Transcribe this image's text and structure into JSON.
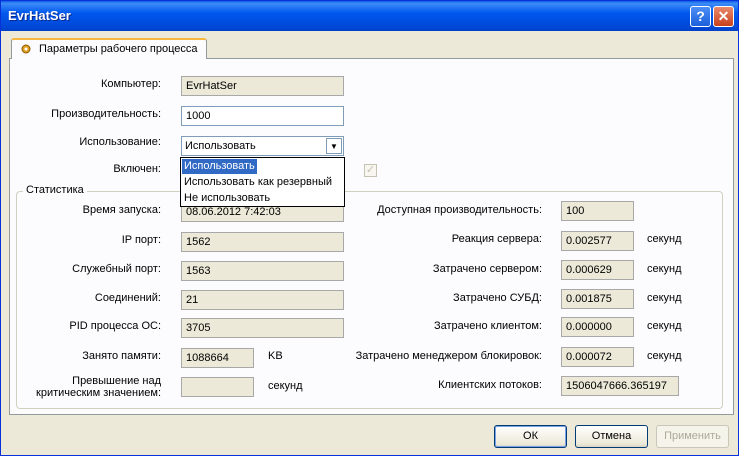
{
  "window": {
    "title": "EvrHatSer"
  },
  "titlebar": {
    "help_label": "?",
    "close_label": "✕"
  },
  "tab": {
    "label": "Параметры рабочего процесса",
    "icon": "gear-icon"
  },
  "form": {
    "computer_label": "Компьютер:",
    "computer_value": "EvrHatSer",
    "performance_label": "Производительность:",
    "performance_value": "1000",
    "usage_label": "Использование:",
    "usage_value": "Использовать",
    "usage_options": [
      "Использовать",
      "Использовать как резервный",
      "Не использовать"
    ],
    "enabled_label": "Включен:",
    "enabled_checked": true
  },
  "stats": {
    "title": "Статистика",
    "start_time_label": "Время запуска:",
    "start_time_value": "08.06.2012 7:42:03",
    "ip_port_label": "IP порт:",
    "ip_port_value": "1562",
    "service_port_label": "Служебный порт:",
    "service_port_value": "1563",
    "connections_label": "Соединений:",
    "connections_value": "21",
    "pid_label": "PID процесса ОС:",
    "pid_value": "3705",
    "memory_label": "Занято памяти:",
    "memory_value": "1088664",
    "memory_unit": "KB",
    "critical_label": "Превышение над критическим значением:",
    "critical_value": "",
    "critical_unit": "секунд",
    "available_perf_label": "Доступная производительность:",
    "available_perf_value": "100",
    "server_reaction_label": "Реакция сервера:",
    "server_reaction_value": "0.002577",
    "server_spent_label": "Затрачено сервером:",
    "server_spent_value": "0.000629",
    "dbms_spent_label": "Затрачено СУБД:",
    "dbms_spent_value": "0.001875",
    "client_spent_label": "Затрачено клиентом:",
    "client_spent_value": "0.000000",
    "lock_spent_label": "Затрачено менеджером блокировок:",
    "lock_spent_value": "0.000072",
    "client_threads_label": "Клиентских потоков:",
    "client_threads_value": "1506047666.365197",
    "seconds_unit": "секунд"
  },
  "buttons": {
    "ok": "ОК",
    "cancel": "Отмена",
    "apply": "Применить"
  }
}
